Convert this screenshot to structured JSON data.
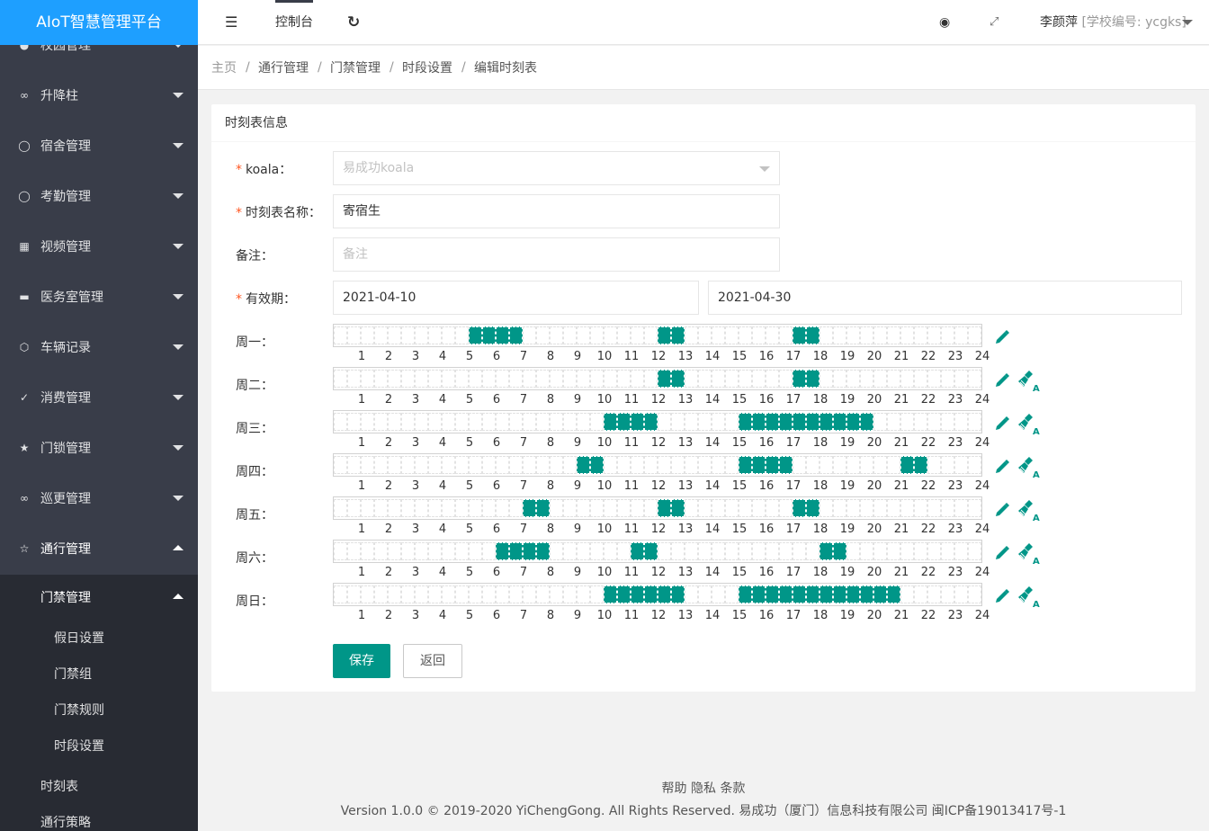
{
  "app": {
    "title": "AIoT智慧管理平台"
  },
  "sidebar": {
    "items": [
      {
        "label": "校园管理",
        "icon": "user-icon"
      },
      {
        "label": "升降柱",
        "icon": "link-icon"
      },
      {
        "label": "宿舍管理",
        "icon": "user-icon"
      },
      {
        "label": "考勤管理",
        "icon": "user-icon"
      },
      {
        "label": "视频管理",
        "icon": "grid-icon"
      },
      {
        "label": "医务室管理",
        "icon": "card-icon"
      },
      {
        "label": "车辆记录",
        "icon": "cube-icon"
      },
      {
        "label": "消费管理",
        "icon": "cart-icon"
      },
      {
        "label": "门锁管理",
        "icon": "star-icon"
      },
      {
        "label": "巡更管理",
        "icon": "link-icon"
      },
      {
        "label": "通行管理",
        "icon": "star-outline-icon"
      }
    ],
    "submenu": {
      "label": "门禁管理",
      "children": [
        "假日设置",
        "门禁组",
        "门禁规则",
        "时段设置"
      ],
      "siblings": [
        "时刻表",
        "通行策略"
      ]
    }
  },
  "header": {
    "tab": "控制台",
    "user": "李颜萍",
    "school": "[学校编号: ycgks]"
  },
  "breadcrumb": [
    "主页",
    "通行管理",
    "门禁管理",
    "时段设置",
    "编辑时刻表"
  ],
  "form": {
    "card_title": "时刻表信息",
    "koala": {
      "label": "koala：",
      "value": "易成功koala"
    },
    "name": {
      "label": "时刻表名称：",
      "value": "寄宿生"
    },
    "remark": {
      "label": "备注：",
      "placeholder": "备注"
    },
    "period": {
      "label": "有效期：",
      "start": "2021-04-10",
      "end": "2021-04-30"
    }
  },
  "schedule": {
    "hour_labels": [
      "1",
      "2",
      "3",
      "4",
      "5",
      "6",
      "7",
      "8",
      "9",
      "10",
      "11",
      "12",
      "13",
      "14",
      "15",
      "16",
      "17",
      "18",
      "19",
      "20",
      "21",
      "22",
      "23",
      "24"
    ],
    "days": [
      {
        "label": "周一：",
        "on": [
          [
            10,
            13
          ],
          [
            24,
            25
          ],
          [
            34,
            35
          ]
        ],
        "clear": false
      },
      {
        "label": "周二：",
        "on": [
          [
            24,
            25
          ],
          [
            34,
            35
          ]
        ],
        "clear": true
      },
      {
        "label": "周三：",
        "on": [
          [
            20,
            23
          ],
          [
            30,
            39
          ]
        ],
        "clear": true
      },
      {
        "label": "周四：",
        "on": [
          [
            18,
            19
          ],
          [
            30,
            33
          ],
          [
            42,
            43
          ]
        ],
        "clear": true
      },
      {
        "label": "周五：",
        "on": [
          [
            14,
            15
          ],
          [
            24,
            25
          ],
          [
            34,
            35
          ]
        ],
        "clear": true
      },
      {
        "label": "周六：",
        "on": [
          [
            12,
            15
          ],
          [
            22,
            23
          ],
          [
            36,
            37
          ]
        ],
        "clear": true
      },
      {
        "label": "周日：",
        "on": [
          [
            20,
            25
          ],
          [
            30,
            41
          ]
        ],
        "clear": true
      }
    ]
  },
  "buttons": {
    "save": "保存",
    "back": "返回"
  },
  "footer": {
    "links": [
      "帮助",
      "隐私",
      "条款"
    ],
    "copyright": "Version 1.0.0 © 2019-2020 YiChengGong. All Rights Reserved. 易成功（厦门）信息科技有限公司 闽ICP备19013417号-1"
  },
  "colors": {
    "accent": "#009688",
    "brand": "#1E9FFF",
    "sidebar": "#393d49",
    "required": "#FF5722"
  }
}
